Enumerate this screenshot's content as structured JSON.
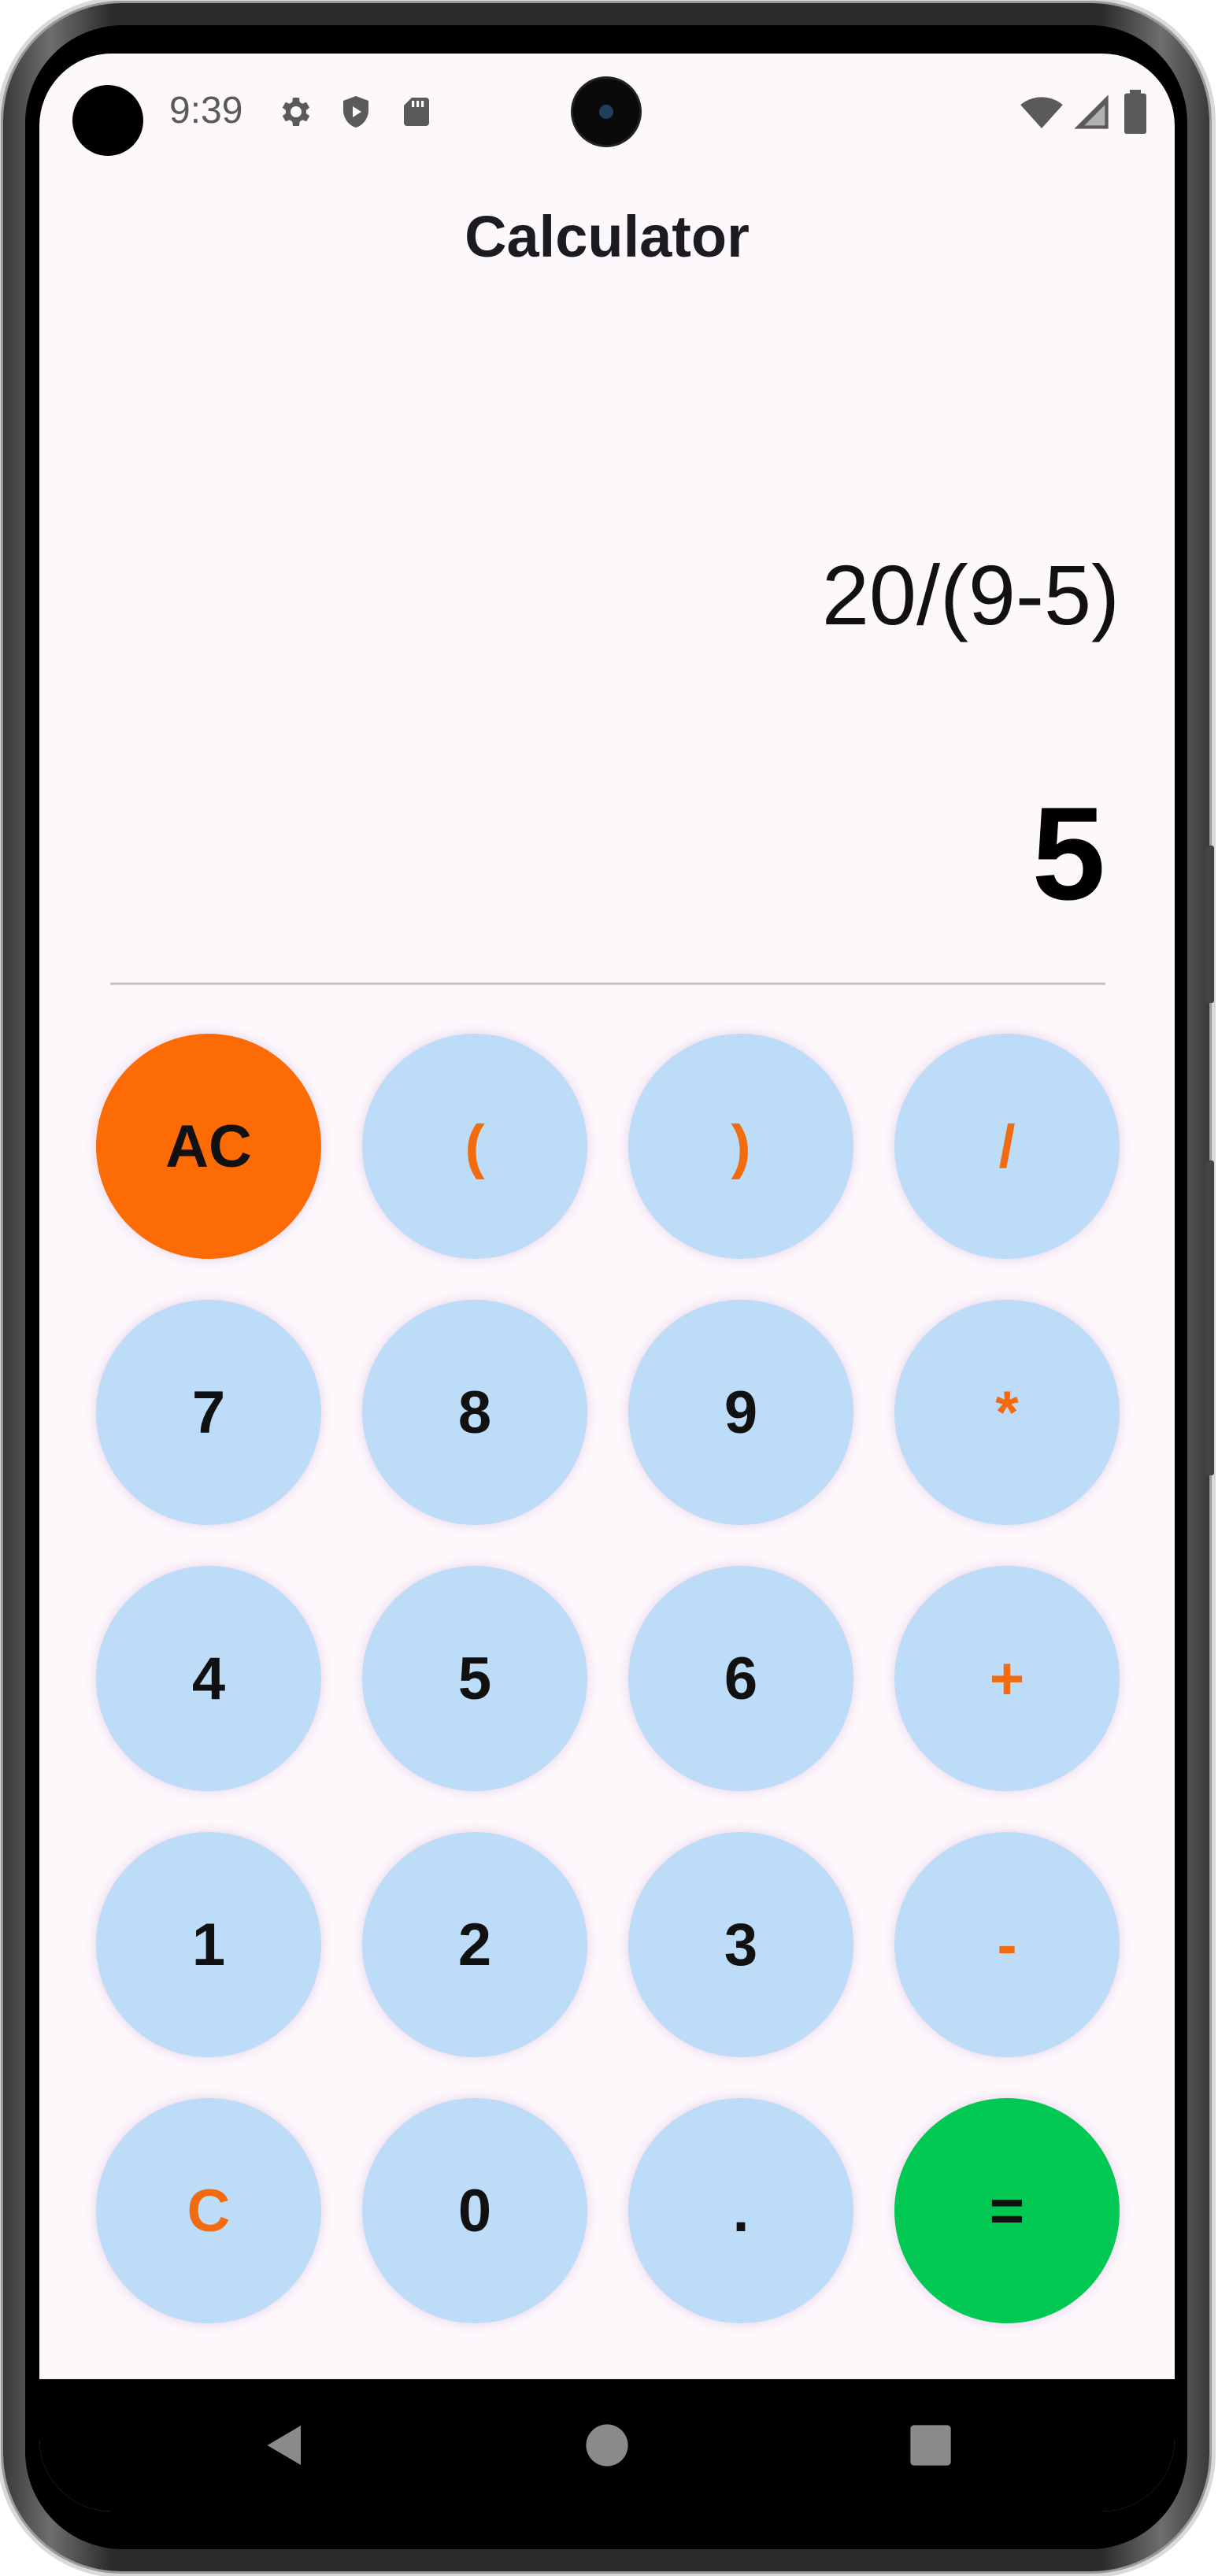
{
  "status_bar": {
    "time": "9:39",
    "left_icons": [
      "gear-icon",
      "shield-play-icon",
      "sd-card-icon"
    ],
    "right_icons": [
      "wifi-icon",
      "signal-icon",
      "battery-icon"
    ]
  },
  "app": {
    "title": "Calculator"
  },
  "display": {
    "expression": "20/(9-5)",
    "result": "5"
  },
  "keypad": {
    "keys": [
      {
        "label": "AC",
        "kind": "clear-all"
      },
      {
        "label": "(",
        "kind": "operator"
      },
      {
        "label": ")",
        "kind": "operator"
      },
      {
        "label": "/",
        "kind": "operator"
      },
      {
        "label": "7",
        "kind": "digit"
      },
      {
        "label": "8",
        "kind": "digit"
      },
      {
        "label": "9",
        "kind": "digit"
      },
      {
        "label": "*",
        "kind": "operator"
      },
      {
        "label": "4",
        "kind": "digit"
      },
      {
        "label": "5",
        "kind": "digit"
      },
      {
        "label": "6",
        "kind": "digit"
      },
      {
        "label": "+",
        "kind": "operator"
      },
      {
        "label": "1",
        "kind": "digit"
      },
      {
        "label": "2",
        "kind": "digit"
      },
      {
        "label": "3",
        "kind": "digit"
      },
      {
        "label": "-",
        "kind": "operator"
      },
      {
        "label": "C",
        "kind": "operator"
      },
      {
        "label": "0",
        "kind": "digit"
      },
      {
        "label": ".",
        "kind": "digit"
      },
      {
        "label": "=",
        "kind": "equals"
      }
    ]
  },
  "colors": {
    "screen_background": "#fdf8fc",
    "key_background": "#bcdcf7",
    "operator_text": "#f26b0f",
    "ac_background": "#fd6b05",
    "equals_background": "#00c853"
  },
  "nav_bar": {
    "buttons": [
      "back-icon",
      "home-icon",
      "recents-icon"
    ]
  }
}
